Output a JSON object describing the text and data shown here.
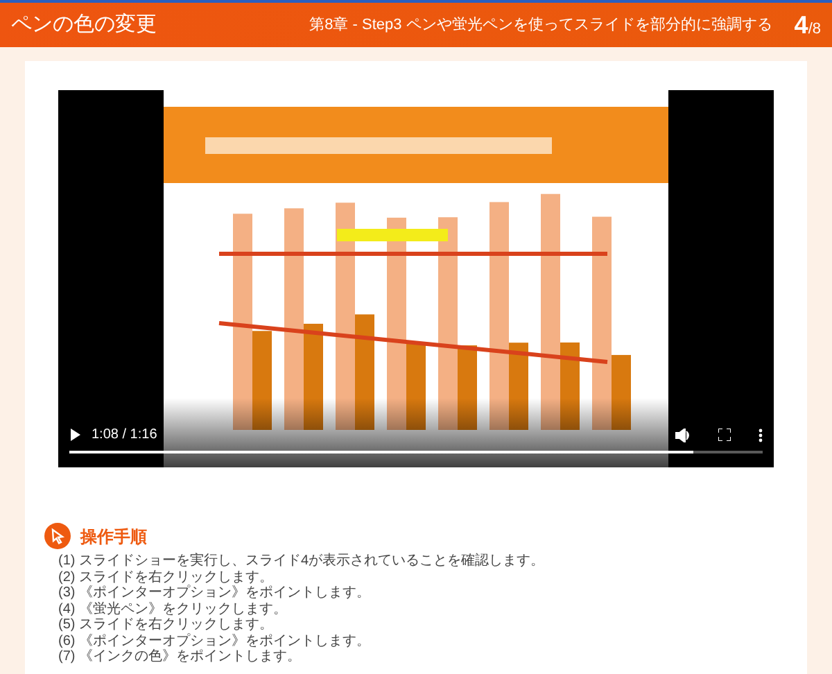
{
  "header": {
    "title": "ペンの色の変更",
    "chapter": "第8章 - Step3 ペンや蛍光ペンを使ってスライドを部分的に強調する",
    "page_current": "4",
    "page_total": "/8"
  },
  "video": {
    "time": "1:08 / 1:16",
    "progress": {
      "level": 0.9
    }
  },
  "procedure": {
    "heading": "操作手順",
    "steps": [
      "(1) スライドショーを実行し、スライド4が表示されていることを確認します。",
      "(2) スライドを右クリックします。",
      "(3) 《ポインターオプション》をポイントします。",
      "(4) 《蛍光ペン》をクリックします。",
      "(5) スライドを右クリックします。",
      "(6) 《ポインターオプション》をポイントします。",
      "(7) 《インクの色》をポイントします。"
    ]
  }
}
